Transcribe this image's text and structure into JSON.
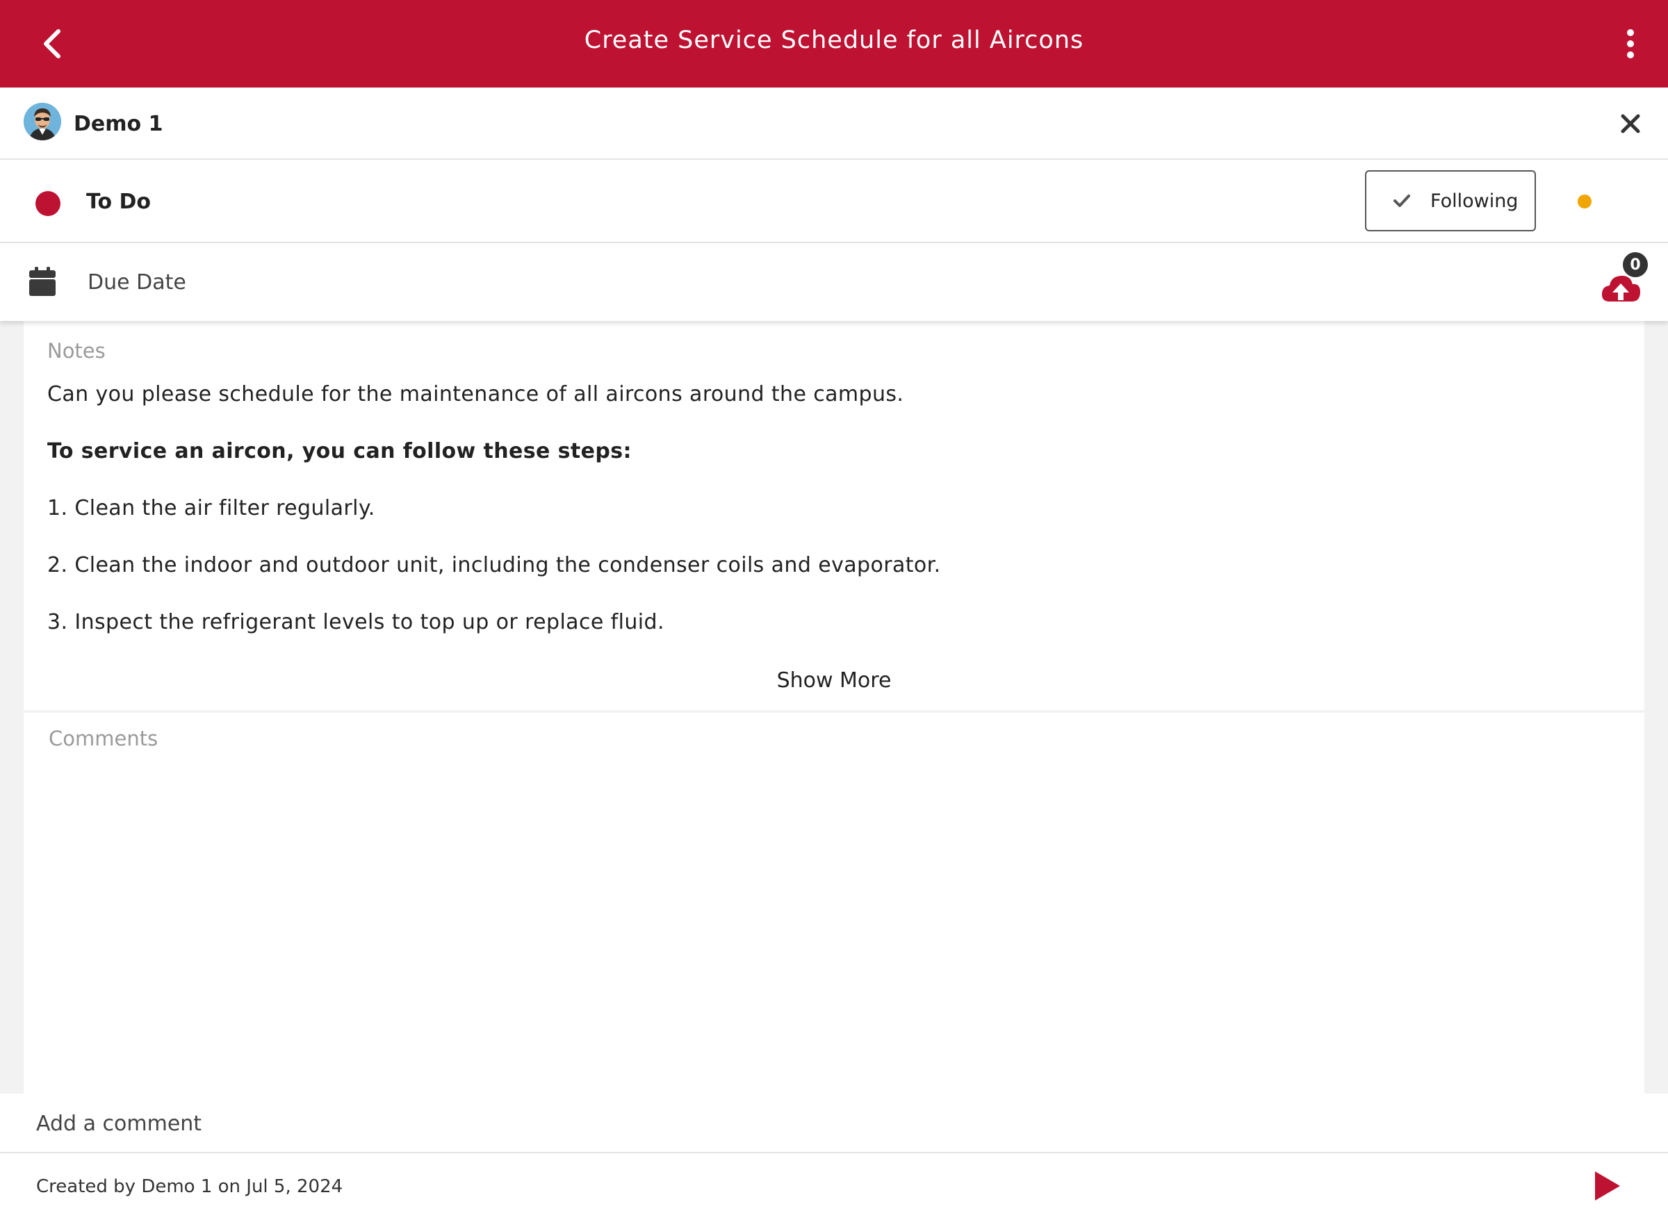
{
  "header": {
    "title": "Create Service Schedule for all Aircons",
    "color": "#be1232"
  },
  "user": {
    "name": "Demo 1"
  },
  "status": {
    "label": "To Do",
    "color": "#be1232",
    "follow_label": "Following",
    "indicator_color": "#f0a500"
  },
  "due": {
    "label": "Due Date",
    "attachments_count": "0"
  },
  "notes": {
    "label": "Notes",
    "lines": [
      "Can you please schedule for the maintenance of all aircons around the campus.",
      "To service an aircon, you can follow these steps:",
      "1. Clean the air filter regularly.",
      "2. Clean the indoor and outdoor unit, including the condenser coils and evaporator.",
      "3. Inspect the refrigerant levels to top up or replace fluid."
    ],
    "show_more": "Show More"
  },
  "comments": {
    "label": "Comments",
    "input_placeholder": "Add a comment"
  },
  "footer": {
    "created": "Created by Demo 1 on Jul 5, 2024"
  },
  "icons": [
    "back-arrow-icon",
    "more-vertical-icon",
    "close-icon",
    "check-icon",
    "calendar-icon",
    "cloud-upload-icon",
    "send-icon"
  ]
}
